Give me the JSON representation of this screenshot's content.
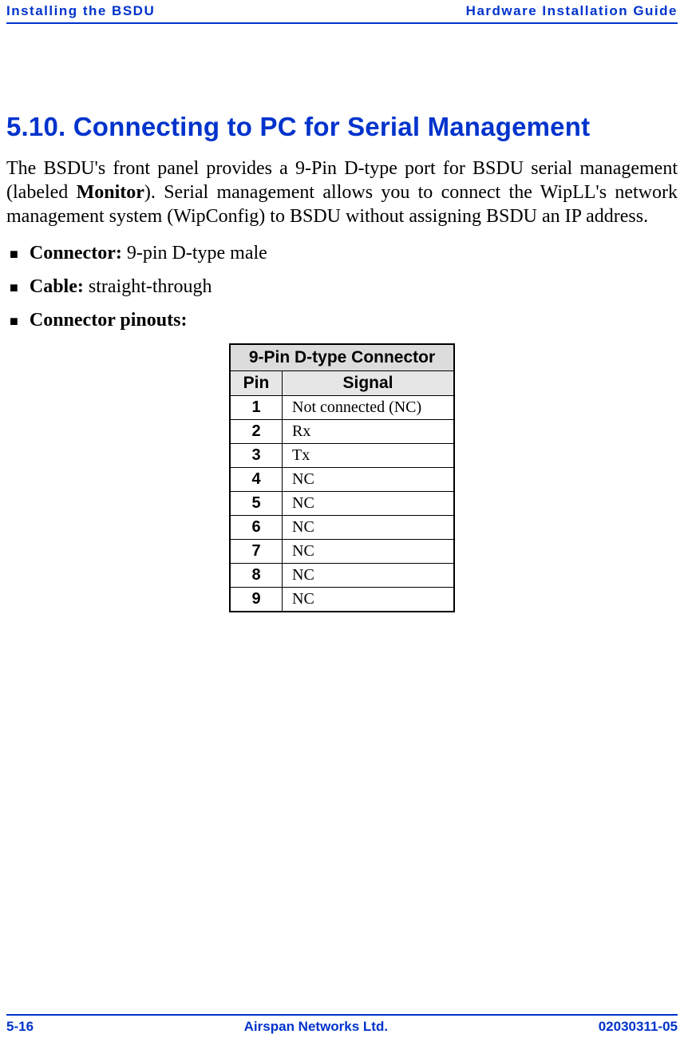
{
  "header": {
    "left": "Installing the BSDU",
    "right": "Hardware Installation Guide"
  },
  "section": {
    "title": "5.10. Connecting to PC for Serial Management",
    "para_pre": "The BSDU's front panel provides a 9-Pin D-type port for BSDU serial management (labeled ",
    "para_bold": "Monitor",
    "para_post": "). Serial management allows you to connect the WipLL's network management system (WipConfig) to BSDU without assigning BSDU an IP address."
  },
  "bullets": [
    {
      "label": "Connector:",
      "value": " 9-pin D-type male"
    },
    {
      "label": "Cable:",
      "value": " straight-through"
    },
    {
      "label": "Connector pinouts:",
      "value": ""
    }
  ],
  "table": {
    "title": "9-Pin D-type Connector",
    "head_pin": "Pin",
    "head_signal": "Signal",
    "rows": [
      {
        "pin": "1",
        "signal": "Not connected (NC)"
      },
      {
        "pin": "2",
        "signal": "Rx"
      },
      {
        "pin": "3",
        "signal": "Tx"
      },
      {
        "pin": "4",
        "signal": "NC"
      },
      {
        "pin": "5",
        "signal": "NC"
      },
      {
        "pin": "6",
        "signal": "NC"
      },
      {
        "pin": "7",
        "signal": "NC"
      },
      {
        "pin": "8",
        "signal": "NC"
      },
      {
        "pin": "9",
        "signal": "NC"
      }
    ]
  },
  "footer": {
    "left": "5-16",
    "center": "Airspan Networks Ltd.",
    "right": "02030311-05"
  }
}
